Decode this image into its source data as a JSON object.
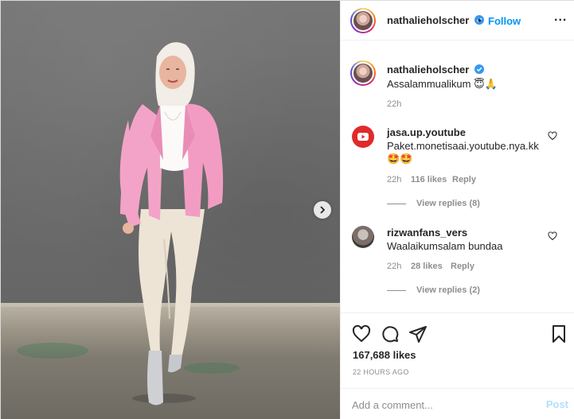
{
  "post_image": {
    "description_icon": "carousel-next-icon"
  },
  "header": {
    "username": "nathalieholscher",
    "separator": "•",
    "follow_label": "Follow",
    "more_label": "..."
  },
  "caption": {
    "username": "nathalieholscher",
    "text": "Assalammualikum 😇🙏",
    "time": "22h"
  },
  "comments": [
    {
      "username": "jasa.up.youtube",
      "line1": "Paket.monetisaai.youtube.nya.kk",
      "line2": "🤩🤩",
      "time": "22h",
      "likes": "116 likes",
      "reply": "Reply",
      "view_replies": "View replies (8)"
    },
    {
      "username": "rizwanfans_vers",
      "line1": "Waalaikumsalam bundaa",
      "time": "22h",
      "likes": "28 likes",
      "reply": "Reply",
      "view_replies": "View replies (2)"
    }
  ],
  "actions": {
    "likes": "167,688 likes",
    "posted_ago": "22 HOURS AGO"
  },
  "comment_box": {
    "placeholder": "Add a comment...",
    "post_label": "Post"
  },
  "colors": {
    "accent": "#0095f6",
    "verified": "#3897f0",
    "muted": "#8e8e8e",
    "post_disabled": "#b2dffc"
  }
}
